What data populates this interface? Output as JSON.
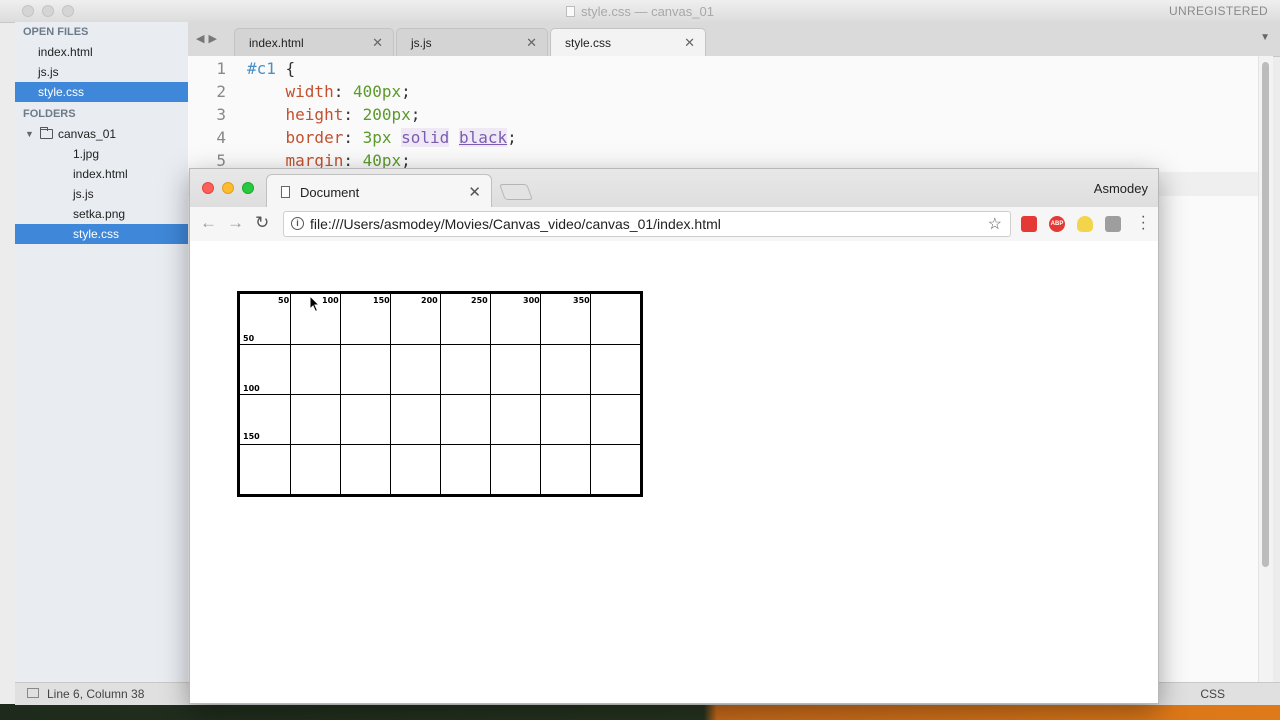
{
  "sublime": {
    "title": "style.css — canvas_01",
    "badge": "UNREGISTERED",
    "sidebar": {
      "open_files_header": "OPEN FILES",
      "open_files": [
        "index.html",
        "js.js",
        "style.css"
      ],
      "folders_header": "FOLDERS",
      "folder_name": "canvas_01",
      "folder_files": [
        "1.jpg",
        "index.html",
        "js.js",
        "setka.png",
        "style.css"
      ],
      "selected": "style.css"
    },
    "tabs": [
      {
        "label": "index.html"
      },
      {
        "label": "js.js"
      },
      {
        "label": "style.css",
        "active": true
      }
    ],
    "code": {
      "line_numbers": [
        "1",
        "2",
        "3",
        "4",
        "5"
      ],
      "l1_selector": "#c1",
      "l1_brace": " {",
      "l2_prop": "width",
      "l2_val": "400px",
      "l3_prop": "height",
      "l3_val": "200px",
      "l4_prop": "border",
      "l4_val": "3px",
      "l4_kw1": "solid",
      "l4_kw2": "black",
      "l5_prop": "margin",
      "l5_val": "40px"
    },
    "status": {
      "position": "Line 6, Column 38",
      "syntax": "CSS"
    }
  },
  "chrome": {
    "tab_title": "Document",
    "profile": "Asmodey",
    "url": "file:///Users/asmodey/Movies/Canvas_video/canvas_01/index.html",
    "extensions": [
      "ABP"
    ],
    "grid": {
      "x_labels": [
        "50",
        "100",
        "150",
        "200",
        "250",
        "300",
        "350"
      ],
      "y_labels": [
        "50",
        "100",
        "150"
      ]
    }
  },
  "colors": {
    "selection": "#3f87d8",
    "css_property": "#c3502e",
    "css_value": "#5b9a2b",
    "css_selector": "#4a90c8",
    "css_keyword": "#7c5cb0"
  }
}
